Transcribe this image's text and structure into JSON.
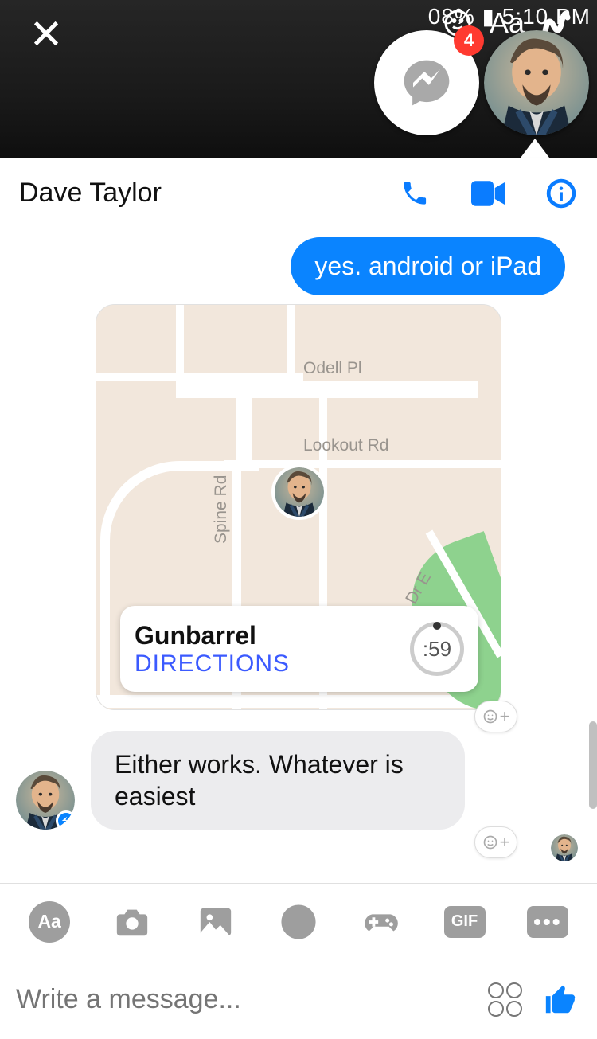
{
  "statusbar": {
    "right_text": "08% ▮ 5:10 PM"
  },
  "overlay": {
    "aa": "Aa"
  },
  "chat_heads": {
    "badge": "4"
  },
  "header": {
    "name": "Dave Taylor"
  },
  "messages": {
    "out1": "yes. android or iPad",
    "in1": "Either works. Whatever is easiest"
  },
  "map": {
    "labels": {
      "odell": "Odell Pl",
      "lookout": "Lookout Rd",
      "spine": "Spine Rd",
      "dre": "Dr E"
    },
    "info": {
      "title": "Gunbarrel",
      "directions": "DIRECTIONS",
      "timer": ":59"
    }
  },
  "toolbar": {
    "aa": "Aa",
    "gif": "GIF",
    "more": "•••"
  },
  "input": {
    "placeholder": "Write a message..."
  }
}
